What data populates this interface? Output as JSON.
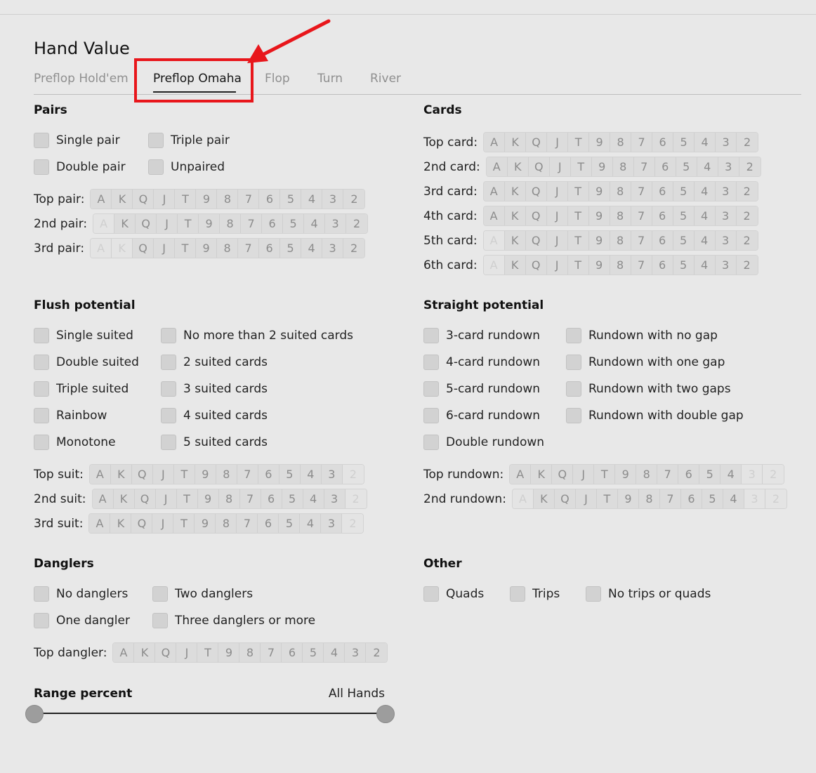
{
  "page": {
    "title": "Hand Value",
    "accent_color": "#e8161b"
  },
  "tabs": [
    {
      "label": "Preflop Hold'em",
      "active": false
    },
    {
      "label": "Preflop Omaha",
      "active": true
    },
    {
      "label": "Flop",
      "active": false
    },
    {
      "label": "Turn",
      "active": false
    },
    {
      "label": "River",
      "active": false
    }
  ],
  "ranks": [
    "A",
    "K",
    "Q",
    "J",
    "T",
    "9",
    "8",
    "7",
    "6",
    "5",
    "4",
    "3",
    "2"
  ],
  "pairs": {
    "title": "Pairs",
    "options": [
      "Single pair",
      "Triple pair",
      "Double pair",
      "Unpaired"
    ],
    "rows": [
      {
        "label": "Top pair:",
        "disabled": []
      },
      {
        "label": "2nd pair:",
        "disabled": [
          "A"
        ]
      },
      {
        "label": "3rd pair:",
        "disabled": [
          "A",
          "K"
        ]
      }
    ]
  },
  "cards": {
    "title": "Cards",
    "rows": [
      {
        "label": "Top card:",
        "disabled": []
      },
      {
        "label": "2nd card:",
        "disabled": []
      },
      {
        "label": "3rd card:",
        "disabled": []
      },
      {
        "label": "4th card:",
        "disabled": []
      },
      {
        "label": "5th card:",
        "disabled": [
          "A"
        ]
      },
      {
        "label": "6th card:",
        "disabled": [
          "A"
        ]
      }
    ]
  },
  "flush": {
    "title": "Flush potential",
    "options": [
      "Single suited",
      "No more than 2 suited cards",
      "Double suited",
      "2 suited cards",
      "Triple suited",
      "3 suited cards",
      "Rainbow",
      "4 suited cards",
      "Monotone",
      "5 suited cards"
    ],
    "rows": [
      {
        "label": "Top suit:",
        "disabled": [
          "2"
        ]
      },
      {
        "label": "2nd suit:",
        "disabled": [
          "2"
        ]
      },
      {
        "label": "3rd suit:",
        "disabled": [
          "2"
        ]
      }
    ]
  },
  "straight": {
    "title": "Straight potential",
    "options": [
      "3-card rundown",
      "Rundown with no gap",
      "4-card rundown",
      "Rundown with one gap",
      "5-card rundown",
      "Rundown with two gaps",
      "6-card rundown",
      "Rundown with double gap",
      "Double rundown"
    ],
    "rows": [
      {
        "label": "Top rundown:",
        "disabled": [
          "3",
          "2"
        ]
      },
      {
        "label": "2nd rundown:",
        "disabled": [
          "A",
          "3",
          "2"
        ]
      }
    ]
  },
  "danglers": {
    "title": "Danglers",
    "options": [
      "No danglers",
      "Two danglers",
      "One dangler",
      "Three danglers or more"
    ],
    "rows": [
      {
        "label": "Top dangler:",
        "disabled": []
      }
    ]
  },
  "other": {
    "title": "Other",
    "options": [
      "Quads",
      "Trips",
      "No trips or quads"
    ]
  },
  "range": {
    "title": "Range percent",
    "value_label": "All Hands",
    "min": 0,
    "max": 100
  }
}
